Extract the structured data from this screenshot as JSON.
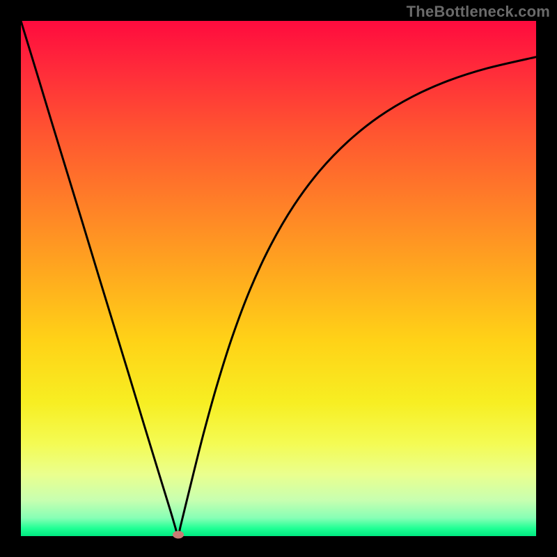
{
  "watermark": "TheBottleneck.com",
  "chart_data": {
    "type": "line",
    "title": "",
    "xlabel": "",
    "ylabel": "",
    "xlim": [
      0,
      100
    ],
    "ylim": [
      0,
      100
    ],
    "grid": false,
    "legend": false,
    "marker": {
      "x": 30.5,
      "y": 0.3,
      "color": "#c97b74"
    },
    "series": [
      {
        "name": "curve",
        "color": "#000000",
        "x": [
          0,
          3,
          6,
          9,
          12,
          15,
          18,
          21,
          24,
          27,
          29,
          30,
          30.5,
          31,
          32,
          33.5,
          35.5,
          38,
          41,
          44.5,
          48.5,
          53,
          58,
          63.5,
          69.5,
          76,
          83,
          90.5,
          100
        ],
        "y": [
          100,
          90.2,
          80.3,
          70.5,
          60.7,
          50.8,
          41.0,
          31.2,
          21.3,
          11.5,
          5.0,
          1.6,
          0,
          2.0,
          6.1,
          12.2,
          20.1,
          29.1,
          38.6,
          47.9,
          56.5,
          64.2,
          70.9,
          76.6,
          81.4,
          85.3,
          88.4,
          90.8,
          93.0
        ]
      }
    ],
    "background_gradient": {
      "direction": "top-to-bottom",
      "stops": [
        {
          "pos": 0,
          "color": "#ff0b3e"
        },
        {
          "pos": 0.35,
          "color": "#ff7e28"
        },
        {
          "pos": 0.62,
          "color": "#ffd217"
        },
        {
          "pos": 0.82,
          "color": "#f4fb53"
        },
        {
          "pos": 0.965,
          "color": "#86ffb5"
        },
        {
          "pos": 1.0,
          "color": "#00e981"
        }
      ]
    }
  }
}
